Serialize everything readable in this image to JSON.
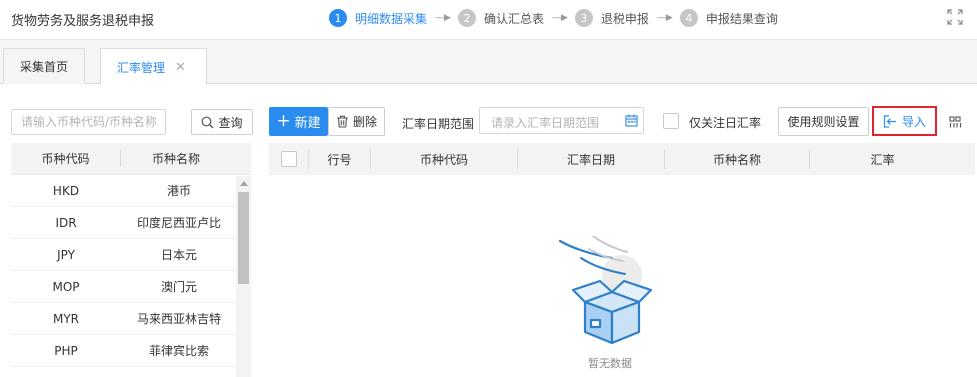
{
  "header": {
    "title": "货物劳务及服务退税申报",
    "steps": [
      {
        "num": "1",
        "label": "明细数据采集"
      },
      {
        "num": "2",
        "label": "确认汇总表"
      },
      {
        "num": "3",
        "label": "退税申报"
      },
      {
        "num": "4",
        "label": "申报结果查询"
      }
    ],
    "arrow": "----▶"
  },
  "tabs": [
    {
      "label": "采集首页"
    },
    {
      "label": "汇率管理",
      "close": "✕"
    }
  ],
  "left_panel": {
    "search_placeholder": "请输入币种代码/币种名称",
    "query_label": "查询",
    "columns": {
      "code": "币种代码",
      "name": "币种名称"
    },
    "rows": [
      {
        "code": "HKD",
        "name": "港币"
      },
      {
        "code": "IDR",
        "name": "印度尼西亚卢比"
      },
      {
        "code": "JPY",
        "name": "日本元"
      },
      {
        "code": "MOP",
        "name": "澳门元"
      },
      {
        "code": "MYR",
        "name": "马来西亚林吉特"
      },
      {
        "code": "PHP",
        "name": "菲律宾比索"
      }
    ]
  },
  "toolbar": {
    "new_label": "新建",
    "new_plus": "+",
    "delete_label": "删除",
    "date_range_label": "汇率日期范围",
    "date_range_placeholder": "请录入汇率日期范围",
    "only_focus_label": "仅关注日汇率",
    "rule_settings_label": "使用规则设置",
    "import_label": "导入"
  },
  "table": {
    "columns": {
      "row": "行号",
      "code": "币种代码",
      "date": "汇率日期",
      "name": "币种名称",
      "rate": "汇率"
    },
    "empty_text": "暂无数据"
  },
  "colors": {
    "accent": "#2b8cf0",
    "highlight_border": "#e0262c"
  }
}
